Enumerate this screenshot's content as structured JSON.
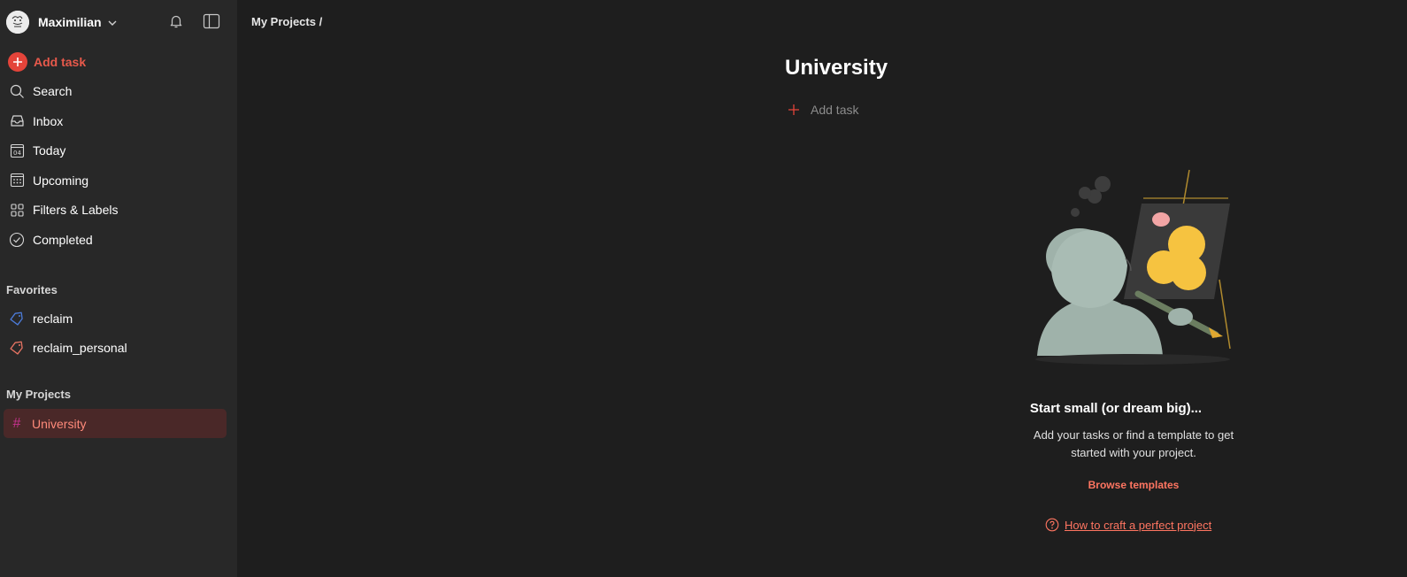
{
  "user": {
    "name": "Maximilian"
  },
  "nav": {
    "add_task": "Add task",
    "items": [
      {
        "label": "Search",
        "icon": "search-icon"
      },
      {
        "label": "Inbox",
        "icon": "inbox-icon"
      },
      {
        "label": "Today",
        "icon": "calendar-today-icon",
        "badge": "04"
      },
      {
        "label": "Upcoming",
        "icon": "calendar-grid-icon"
      },
      {
        "label": "Filters & Labels",
        "icon": "grid-icon"
      },
      {
        "label": "Completed",
        "icon": "check-circle-icon"
      }
    ]
  },
  "favorites": {
    "title": "Favorites",
    "items": [
      {
        "label": "reclaim",
        "color": "#4c7cdb"
      },
      {
        "label": "reclaim_personal",
        "color": "#e87463"
      }
    ]
  },
  "projects": {
    "title": "My Projects",
    "items": [
      {
        "label": "University",
        "hash": "#"
      }
    ]
  },
  "main": {
    "breadcrumb": "My Projects /",
    "title": "University",
    "add_task": "Add task",
    "empty": {
      "title": "Start small (or dream big)...",
      "description": "Add your tasks or find a template to get started with your project.",
      "browse": "Browse templates",
      "help": "How to craft a perfect project"
    }
  },
  "colors": {
    "accent": "#e4443a",
    "link": "#ff7561",
    "sidebar_bg": "#282828",
    "main_bg": "#1e1e1e",
    "active_bg": "#4a2828"
  }
}
